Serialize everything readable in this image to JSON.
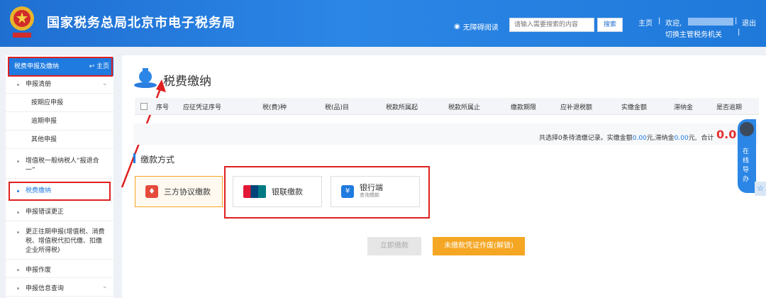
{
  "header": {
    "title": "国家税务总局北京市电子税务局",
    "accessibility": "无障碍阅读",
    "search_placeholder": "请输入需要搜索的内容",
    "search_button": "搜索",
    "home": "主页",
    "welcome": "欢迎,",
    "logout": "退出",
    "switch_org": "切换主管税务机关",
    "sep": "|"
  },
  "sidebar": {
    "header": "税费申报及缴纳",
    "home": "主页",
    "items": [
      {
        "label": "申报清册"
      },
      {
        "label": "按期应申报"
      },
      {
        "label": "逾期申报"
      },
      {
        "label": "其他申报"
      },
      {
        "label": "增值税一般纳税人“报退合一”"
      },
      {
        "label": "税费缴纳"
      },
      {
        "label": "申报错误更正"
      },
      {
        "label": "更正往期申报(增值税、消费税、增值税代扣代缴、扣缴企业所得税)"
      },
      {
        "label": "申报作废"
      },
      {
        "label": "申报信息查询"
      }
    ]
  },
  "main": {
    "title": "税费缴纳",
    "columns": [
      "序号",
      "应征凭证序号",
      "税(费)种",
      "税(品)目",
      "税款所属起",
      "税款所属止",
      "缴款期限",
      "应补退税额",
      "实缴金额",
      "滞纳金",
      "是否逾期"
    ],
    "summary_prefix": "共选择0条待清缴记录。实缴金额",
    "summary_amount": "0.00",
    "summary_unit1": "元,滞纳金",
    "summary_late": "0.00",
    "summary_unit2": "元,",
    "total_label": "合计",
    "total_value": "0.0",
    "pay_method_title": "缴款方式",
    "methods": [
      "三方协议缴款",
      "银联缴款",
      "银行端"
    ],
    "bank_sub": "查询缴款",
    "btn_pay": "立即缴款",
    "btn_void": "未缴款凭证作废(解锁)"
  },
  "float_service": "在线导办",
  "colors": {
    "accent": "#1f7be0",
    "orange": "#f5a623",
    "red": "#e02020"
  }
}
